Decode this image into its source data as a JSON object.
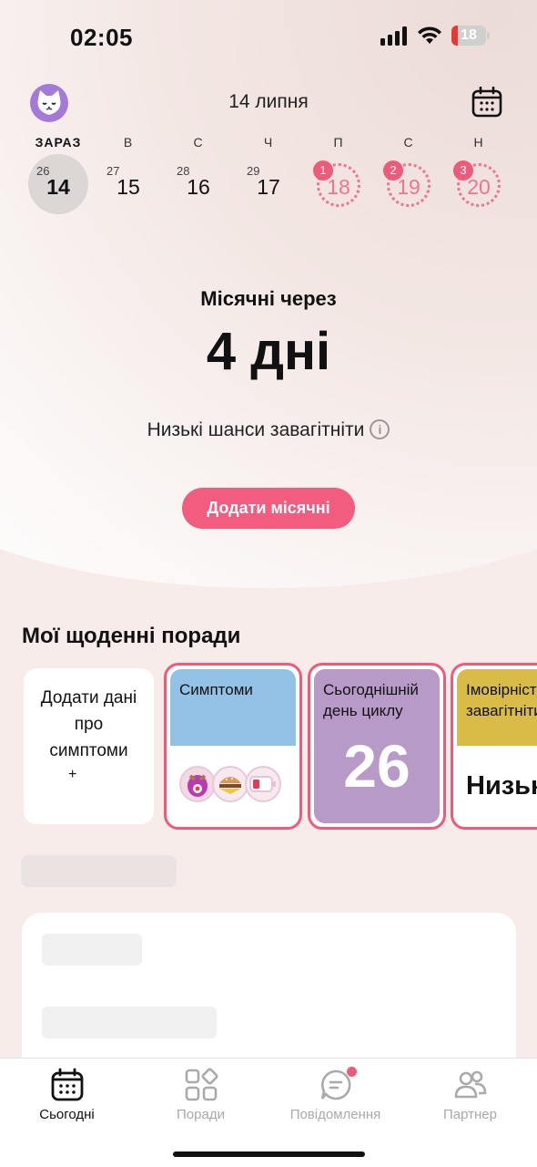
{
  "status_bar": {
    "time": "02:05",
    "battery": "18",
    "battery_level": 0.18
  },
  "header": {
    "month_title": "14 липня"
  },
  "week": [
    {
      "dow": "ЗАРАЗ",
      "cycle_day": "26",
      "date": "14",
      "state": "today"
    },
    {
      "dow": "В",
      "cycle_day": "27",
      "date": "15",
      "state": "normal"
    },
    {
      "dow": "С",
      "cycle_day": "28",
      "date": "16",
      "state": "normal"
    },
    {
      "dow": "Ч",
      "cycle_day": "29",
      "date": "17",
      "state": "normal"
    },
    {
      "dow": "П",
      "badge": "1",
      "date": "18",
      "state": "predicted"
    },
    {
      "dow": "С",
      "badge": "2",
      "date": "19",
      "state": "predicted"
    },
    {
      "dow": "Н",
      "badge": "3",
      "date": "20",
      "state": "predicted"
    }
  ],
  "hero": {
    "label": "Місячні через",
    "value": "4 дні",
    "chance": "Низькі шанси завагітніти",
    "info_icon": "i",
    "add_button": "Додати місячні"
  },
  "daily_tips": {
    "title": "Мої щоденні поради",
    "add_card": {
      "line1": "Додати дані",
      "line2": "про",
      "line3": "симптоми",
      "plus": "+"
    },
    "symptoms": {
      "title": "Симптоми"
    },
    "cycle_day": {
      "title_line1": "Сьогоднішній",
      "title_line2": "день циклу",
      "value": "26"
    },
    "pregnancy": {
      "title_line1": "Імовірність",
      "title_line2": "завагітніти",
      "value": "Низька"
    }
  },
  "tabs": [
    {
      "label": "Сьогодні",
      "icon": "calendar-icon",
      "active": true
    },
    {
      "label": "Поради",
      "icon": "grid-icon",
      "active": false
    },
    {
      "label": "Повідомлення",
      "icon": "chat-icon",
      "active": false
    },
    {
      "label": "Партнер",
      "icon": "partner-icon",
      "active": false
    }
  ],
  "colors": {
    "accent": "#f25c7e",
    "symptoms_header": "#93c2e6",
    "cycle_card": "#b79ac8",
    "pregnancy_header": "#d9bb47",
    "avatar": "#a47ad8"
  }
}
